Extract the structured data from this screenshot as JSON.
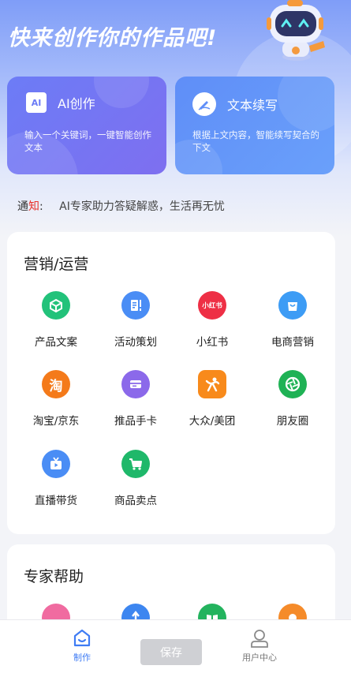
{
  "hero": {
    "slogan": "快来创作你的作品吧!"
  },
  "cards": [
    {
      "title": "AI创作",
      "desc": "输入一个关键词，一键智能创作文本",
      "icon_text": "AI",
      "icon": "ai-icon"
    },
    {
      "title": "文本续写",
      "desc": "根据上文内容，智能续写契合的下文",
      "icon": "pen-icon"
    }
  ],
  "notice": {
    "prefix": "通",
    "highlight": "知",
    "colon": ":",
    "message": "AI专家助力答疑解惑，生活再无忧"
  },
  "marketing": {
    "title": "营销/运营",
    "items": [
      {
        "label": "产品文案",
        "icon": "cube-icon",
        "color": "#22c27a"
      },
      {
        "label": "活动策划",
        "icon": "document-icon",
        "color": "#4a8df5"
      },
      {
        "label": "小红书",
        "icon": "xiaohongshu-icon",
        "color": "#ee2f45",
        "icon_text": "小红书"
      },
      {
        "label": "电商营销",
        "icon": "shopping-bag-icon",
        "color": "#3d9cf5"
      },
      {
        "label": "淘宝/京东",
        "icon": "taobao-icon",
        "color": "#f47a1a",
        "icon_text": "淘"
      },
      {
        "label": "推品手卡",
        "icon": "card-icon",
        "color": "#8b69ea"
      },
      {
        "label": "大众/美团",
        "icon": "dianping-icon",
        "color": "#f88a1b"
      },
      {
        "label": "朋友圈",
        "icon": "aperture-icon",
        "color": "#1fb255"
      },
      {
        "label": "直播带货",
        "icon": "tv-icon",
        "color": "#4a8df5"
      },
      {
        "label": "商品卖点",
        "icon": "cart-icon",
        "color": "#1fb86a"
      }
    ]
  },
  "expert": {
    "title": "专家帮助",
    "items": [
      {
        "icon": "expert-icon-1",
        "color": "#f06ba0"
      },
      {
        "icon": "expert-icon-2",
        "color": "#3d86f0"
      },
      {
        "icon": "book-icon",
        "color": "#23b35e"
      },
      {
        "icon": "expert-icon-4",
        "color": "#f58b2a"
      }
    ]
  },
  "tabbar": {
    "create_label": "制作",
    "save_label": "保存",
    "user_label": "用户中心",
    "active_color": "#3f7cf4"
  }
}
